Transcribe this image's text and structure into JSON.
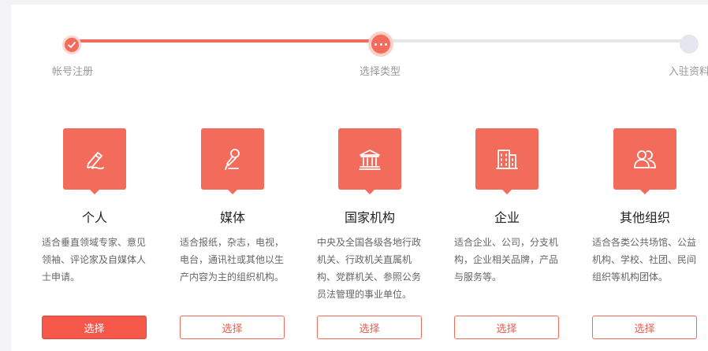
{
  "stepper": {
    "steps": [
      {
        "label": "帐号注册",
        "state": "done"
      },
      {
        "label": "选择类型",
        "state": "current"
      },
      {
        "label": "入驻资料",
        "state": "todo"
      }
    ]
  },
  "cards": [
    {
      "icon": "pen-icon",
      "title": "个人",
      "desc": "适合垂直领域专家、意见领袖、评论家及自媒体人士申请。",
      "button": "选择",
      "selected": true
    },
    {
      "icon": "microphone-icon",
      "title": "媒体",
      "desc": "适合报纸，杂志，电视，电台，通讯社或其他以生产内容为主的组织机构。",
      "button": "选择",
      "selected": false
    },
    {
      "icon": "institution-icon",
      "title": "国家机构",
      "desc": "中央及全国各级各地行政机关、行政机关直属机构、党群机关、参照公务员法管理的事业单位。",
      "button": "选择",
      "selected": false
    },
    {
      "icon": "building-icon",
      "title": "企业",
      "desc": "适合企业、公司，分支机构，企业相关品牌，产品与服务等。",
      "button": "选择",
      "selected": false
    },
    {
      "icon": "people-icon",
      "title": "其他组织",
      "desc": "适合各类公共场馆、公益机构、学校、社团、民间组织等机构团体。",
      "button": "选择",
      "selected": false
    }
  ],
  "colors": {
    "accent": "#f26b5b",
    "track": "#e6e6ef"
  }
}
